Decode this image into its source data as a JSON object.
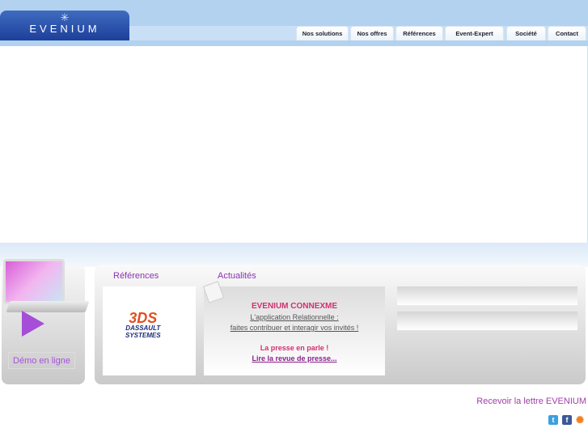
{
  "header": {
    "logo_text": "EVENIUM",
    "tabs": [
      "Nos solutions",
      "Nos offres",
      "Références",
      "Event-Expert",
      "Société",
      "Contact"
    ]
  },
  "demo": {
    "label": "Démo en ligne"
  },
  "references": {
    "title": "Références",
    "logo_line1": "DASSAULT",
    "logo_line2": "SYSTEMES"
  },
  "actualites": {
    "title": "Actualités",
    "headline": "EVENIUM CONNEXME",
    "line1": "L'application Relationnelle :",
    "line2": "faites contribuer et interagir vos invités !",
    "press": "La presse en parle !",
    "press_link": "Lire la revue de presse..."
  },
  "footer": {
    "newsletter": "Recevoir la lettre EVENIUM",
    "social": [
      "twitter",
      "facebook",
      "rss"
    ]
  }
}
